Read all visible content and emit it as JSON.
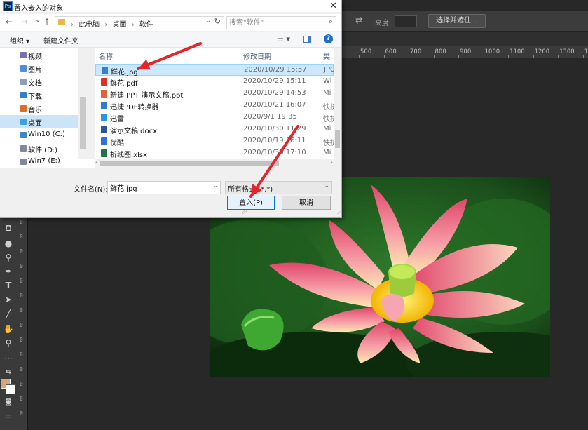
{
  "dialog": {
    "title": "置入嵌入的对象",
    "app_icon_label": "Ps",
    "nav": {
      "back": "←",
      "forward": "→",
      "up_dropdown": "⌄",
      "up": "↑"
    },
    "breadcrumb": [
      "此电脑",
      "桌面",
      "软件"
    ],
    "search_placeholder": "搜索\"软件\"",
    "toolbar": {
      "organize": "组织 ▾",
      "new_folder": "新建文件夹"
    },
    "tree": [
      {
        "label": "视频",
        "color": "#7a6fb0"
      },
      {
        "label": "图片",
        "color": "#4b8fd8"
      },
      {
        "label": "文档",
        "color": "#8aa0b8"
      },
      {
        "label": "下载",
        "color": "#2d7fd1"
      },
      {
        "label": "音乐",
        "color": "#d96f2b"
      },
      {
        "label": "桌面",
        "color": "#3aa0e8",
        "active": true
      },
      {
        "label": "Win10 (C:)",
        "color": "#3a86c8"
      },
      {
        "label": "软件 (D:)",
        "color": "#7f8a96"
      },
      {
        "label": "Win7 (E:)",
        "color": "#7f8a96"
      }
    ],
    "columns": {
      "name": "名称",
      "date": "修改日期",
      "type": "类"
    },
    "files": [
      {
        "name": "鲜花.jpg",
        "date": "2020/10/29 15:57",
        "type": "JPG",
        "icon_color": "#3a7bd5",
        "selected": true
      },
      {
        "name": "鲜花.pdf",
        "date": "2020/10/29 15:11",
        "type": "Wi",
        "icon_color": "#d9302c"
      },
      {
        "name": "新建 PPT 演示文稿.ppt",
        "date": "2020/10/29 14:53",
        "type": "Mi",
        "icon_color": "#e0613a"
      },
      {
        "name": "迅捷PDF转换器",
        "date": "2020/10/21 16:07",
        "type": "快捷",
        "icon_color": "#2f7bd8"
      },
      {
        "name": "迅雷",
        "date": "2020/9/1 19:35",
        "type": "快捷",
        "icon_color": "#2a93e6"
      },
      {
        "name": "演示文稿.docx",
        "date": "2020/10/30 11:29",
        "type": "Mi",
        "icon_color": "#2b579a"
      },
      {
        "name": "优酷",
        "date": "2020/10/19 16:11",
        "type": "快捷",
        "icon_color": "#2f6fe0"
      },
      {
        "name": "折线图.xlsx",
        "date": "2020/10/30 17:10",
        "type": "Mi",
        "icon_color": "#217346"
      }
    ],
    "filename_label": "文件名(N):",
    "filename_value": "鲜花.jpg",
    "filetype_value": "所有格式 (*.*)",
    "place_button": "置入(P)",
    "cancel_button": "取消"
  },
  "photoshop": {
    "height_label": "高度:",
    "select_mask_button": "选择并遮住...",
    "ruler_ticks": [
      "500",
      "600",
      "700",
      "800",
      "900",
      "1000",
      "1100",
      "1200",
      "1300",
      "1400"
    ],
    "vruler_ticks": [
      "0",
      "0",
      "0",
      "0",
      "0",
      "0",
      "0",
      "0",
      "0",
      "0",
      "0",
      "0",
      "0",
      "0"
    ],
    "tools": [
      "paint-bucket",
      "drop",
      "dodge",
      "pen",
      "type",
      "path-select",
      "line",
      "hand",
      "zoom",
      "more"
    ]
  },
  "colors": {
    "accent": "#0078d7",
    "annotation_arrow": "#e8242b",
    "selection_bg": "#cce8ff"
  }
}
